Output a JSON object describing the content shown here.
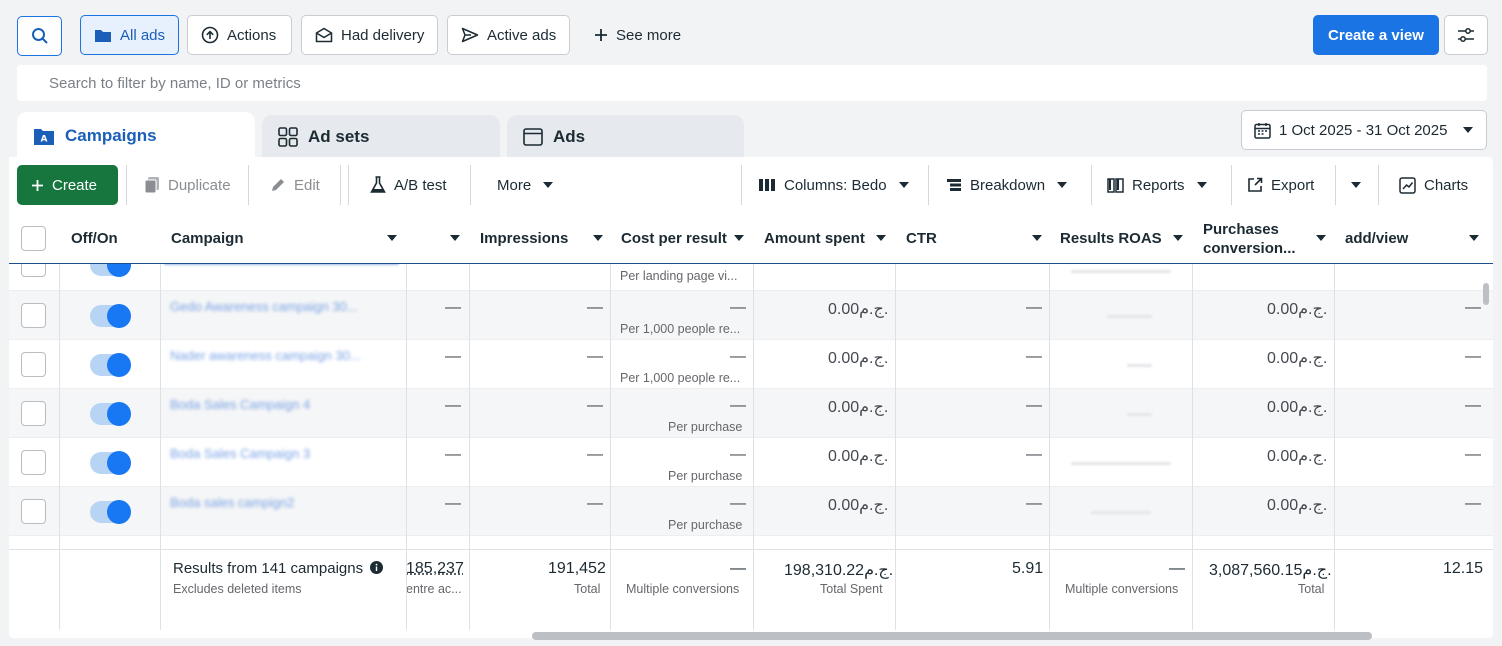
{
  "toolbar": {
    "all_ads": "All ads",
    "actions": "Actions",
    "had_delivery": "Had delivery",
    "active_ads": "Active ads",
    "see_more": "See more",
    "create_view": "Create a view"
  },
  "search": {
    "placeholder": "Search to filter by name, ID or metrics"
  },
  "tabs": {
    "campaigns": "Campaigns",
    "ad_sets": "Ad sets",
    "ads": "Ads"
  },
  "date_range": "1 Oct 2025 - 31 Oct 2025",
  "actions_bar": {
    "create": "Create",
    "duplicate": "Duplicate",
    "edit": "Edit",
    "ab_test": "A/B test",
    "more": "More",
    "columns": "Columns: Bedo",
    "breakdown": "Breakdown",
    "reports": "Reports",
    "export": "Export",
    "charts": "Charts"
  },
  "table": {
    "headers": {
      "off_on": "Off/On",
      "campaign": "Campaign",
      "impressions": "Impressions",
      "cost_per_result": "Cost per result",
      "amount_spent": "Amount spent",
      "ctr": "CTR",
      "results_roas": "Results ROAS",
      "purchases_conversion_1": "Purchases",
      "purchases_conversion_2": "conversion...",
      "add_view": "add/view"
    },
    "rows": [
      {
        "name": "Gedo Awareness campaign 30...",
        "col3": "—",
        "impressions": "—",
        "cost": "—",
        "cost_sub": "Per 1,000 people re...",
        "spent": "0.00ج.م.",
        "ctr": "—",
        "purchases": "0.00ج.م.",
        "add_view": "—"
      },
      {
        "name": "Nader awareness campaign 30...",
        "col3": "—",
        "impressions": "—",
        "cost": "—",
        "cost_sub": "Per 1,000 people re...",
        "spent": "0.00ج.م.",
        "ctr": "—",
        "purchases": "0.00ج.م.",
        "add_view": "—"
      },
      {
        "name": "Boda Sales Campaign 4",
        "col3": "—",
        "impressions": "—",
        "cost": "—",
        "cost_sub": "Per purchase",
        "spent": "0.00ج.م.",
        "ctr": "—",
        "purchases": "0.00ج.م.",
        "add_view": "—"
      },
      {
        "name": "Boda Sales Campaign 3",
        "col3": "—",
        "impressions": "—",
        "cost": "—",
        "cost_sub": "Per purchase",
        "spent": "0.00ج.م.",
        "ctr": "—",
        "purchases": "0.00ج.م.",
        "add_view": "—"
      },
      {
        "name": "Boda sales campign2",
        "col3": "—",
        "impressions": "—",
        "cost": "—",
        "cost_sub": "Per purchase",
        "spent": "0.00ج.م.",
        "ctr": "—",
        "purchases": "0.00ج.م.",
        "add_view": "—"
      }
    ],
    "partial_top_sub": "Per landing page vi...",
    "totals": {
      "results": "Results from 141 campaigns",
      "excludes": "Excludes deleted items",
      "col3": "185,237",
      "col3_sub": "entre ac...",
      "impressions": "191,452",
      "impressions_sub": "Total",
      "cost": "—",
      "cost_sub": "Multiple conversions",
      "spent": "198,310.22ج.م.",
      "spent_sub": "Total Spent",
      "ctr": "5.91",
      "roas": "—",
      "roas_sub": "Multiple conversions",
      "purchases": "3,087,560.15ج.م.",
      "purchases_sub": "Total",
      "add_view": "12.15"
    }
  },
  "colors": {
    "accent": "#1b74e4",
    "create_green": "#16763e",
    "toggle_on": "#1877f2"
  }
}
